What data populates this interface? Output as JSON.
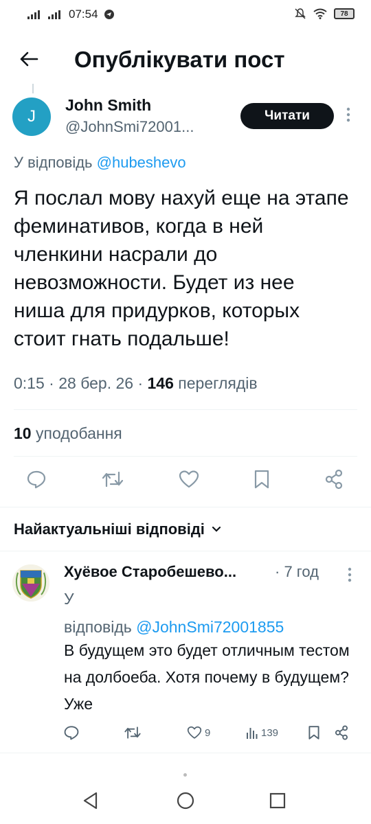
{
  "status_bar": {
    "time": "07:54",
    "battery": "78"
  },
  "header": {
    "title": "Опублікувати пост"
  },
  "post": {
    "avatar_letter": "J",
    "author_name": "John Smith",
    "author_handle": "@JohnSmi72001...",
    "follow_label": "Читати",
    "reply_prefix": "У відповідь ",
    "reply_to": "@hubeshevo",
    "text": "Я послал мову нахуй еще на этапе феминативов, когда в ней членкини насрали до невозможности. Будет из нее ниша для придурков, которых стоит гнать подальше!",
    "time": "0:15",
    "date": "28 бер. 26",
    "views_count": "146",
    "views_label": "переглядів",
    "likes_count": "10",
    "likes_label": "уподобання"
  },
  "replies_section": {
    "title": "Найактуальніші відповіді"
  },
  "reply": {
    "author_name": "Хуёвое Старобешево...",
    "time": "· 7 год",
    "reply_prefix_1": "У",
    "reply_prefix_2": "відповідь ",
    "reply_to": "@JohnSmi72001855",
    "text": "В будущем это будет отличным тестом на долбоеба. Хотя почему в будущем? Уже",
    "likes": "9",
    "views": "139"
  },
  "icons": {
    "back": "arrow-left-icon",
    "reply": "comment-icon",
    "retweet": "repost-icon",
    "like": "heart-icon",
    "bookmark": "bookmark-icon",
    "share": "share-icon",
    "views": "bar-chart-icon",
    "more": "more-vertical-icon"
  },
  "colors": {
    "accent": "#1d9bf0",
    "avatar": "#23a0c4",
    "text_secondary": "#536471"
  }
}
